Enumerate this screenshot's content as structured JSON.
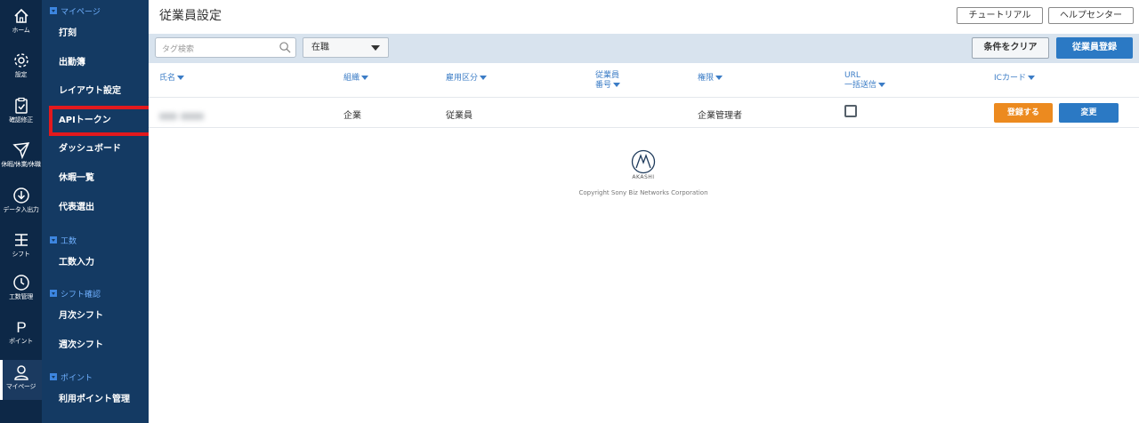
{
  "rail": [
    {
      "label": "ホーム",
      "icon": "home-icon"
    },
    {
      "label": "設定",
      "icon": "gear-icon"
    },
    {
      "label": "確認修正",
      "icon": "clipboard-check-icon"
    },
    {
      "label": "休暇/休業/休職",
      "icon": "paper-plane-icon"
    },
    {
      "label": "データ入出力",
      "icon": "download-circle-icon"
    },
    {
      "label": "シフト",
      "icon": "shift-icon"
    },
    {
      "label": "工数管理",
      "icon": "clock-icon"
    },
    {
      "label": "ポイント",
      "icon": "point-p-icon"
    },
    {
      "label": "マイページ",
      "icon": "user-icon"
    }
  ],
  "nav": {
    "sections": {
      "mypage": "マイページ",
      "kosu": "工数",
      "shift": "シフト確認",
      "point": "ポイント"
    },
    "items": {
      "dakoku": "打刻",
      "shukkinbo": "出勤簿",
      "layout": "レイアウト設定",
      "api_token": "APIトークン",
      "dashboard": "ダッシュボード",
      "kyuka_ichiran": "休暇一覧",
      "daihyo": "代表選出",
      "kosu_input": "工数入力",
      "monthly_shift": "月次シフト",
      "weekly_shift": "週次シフト",
      "point_manage": "利用ポイント管理"
    }
  },
  "header": {
    "title": "従業員設定",
    "tutorial_label": "チュートリアル",
    "help_label": "ヘルプセンター"
  },
  "filter": {
    "search_placeholder": "タグ検索",
    "status_value": "在職",
    "clear_label": "条件をクリア",
    "register_label": "従業員登録"
  },
  "table": {
    "headers": {
      "name": "氏名",
      "org": "組織",
      "employment": "雇用区分",
      "emp_no_1": "従業員",
      "emp_no_2": "番号",
      "role": "権限",
      "url_1": "URL",
      "url_2": "一括送信",
      "ic_card": "ICカード"
    },
    "row": {
      "org": "企業",
      "employment": "従業員",
      "role": "企業管理者",
      "register_btn": "登録する",
      "change_btn": "変更"
    }
  },
  "footer": {
    "logo_text": "AKASHI",
    "copyright": "Copyright Sony Biz Networks Corporation"
  },
  "colors": {
    "rail_bg": "#0d2847",
    "nav_bg": "#143a63",
    "accent_blue": "#2b79c4",
    "accent_orange": "#ec8a1f",
    "highlight_red": "#e3191d"
  }
}
